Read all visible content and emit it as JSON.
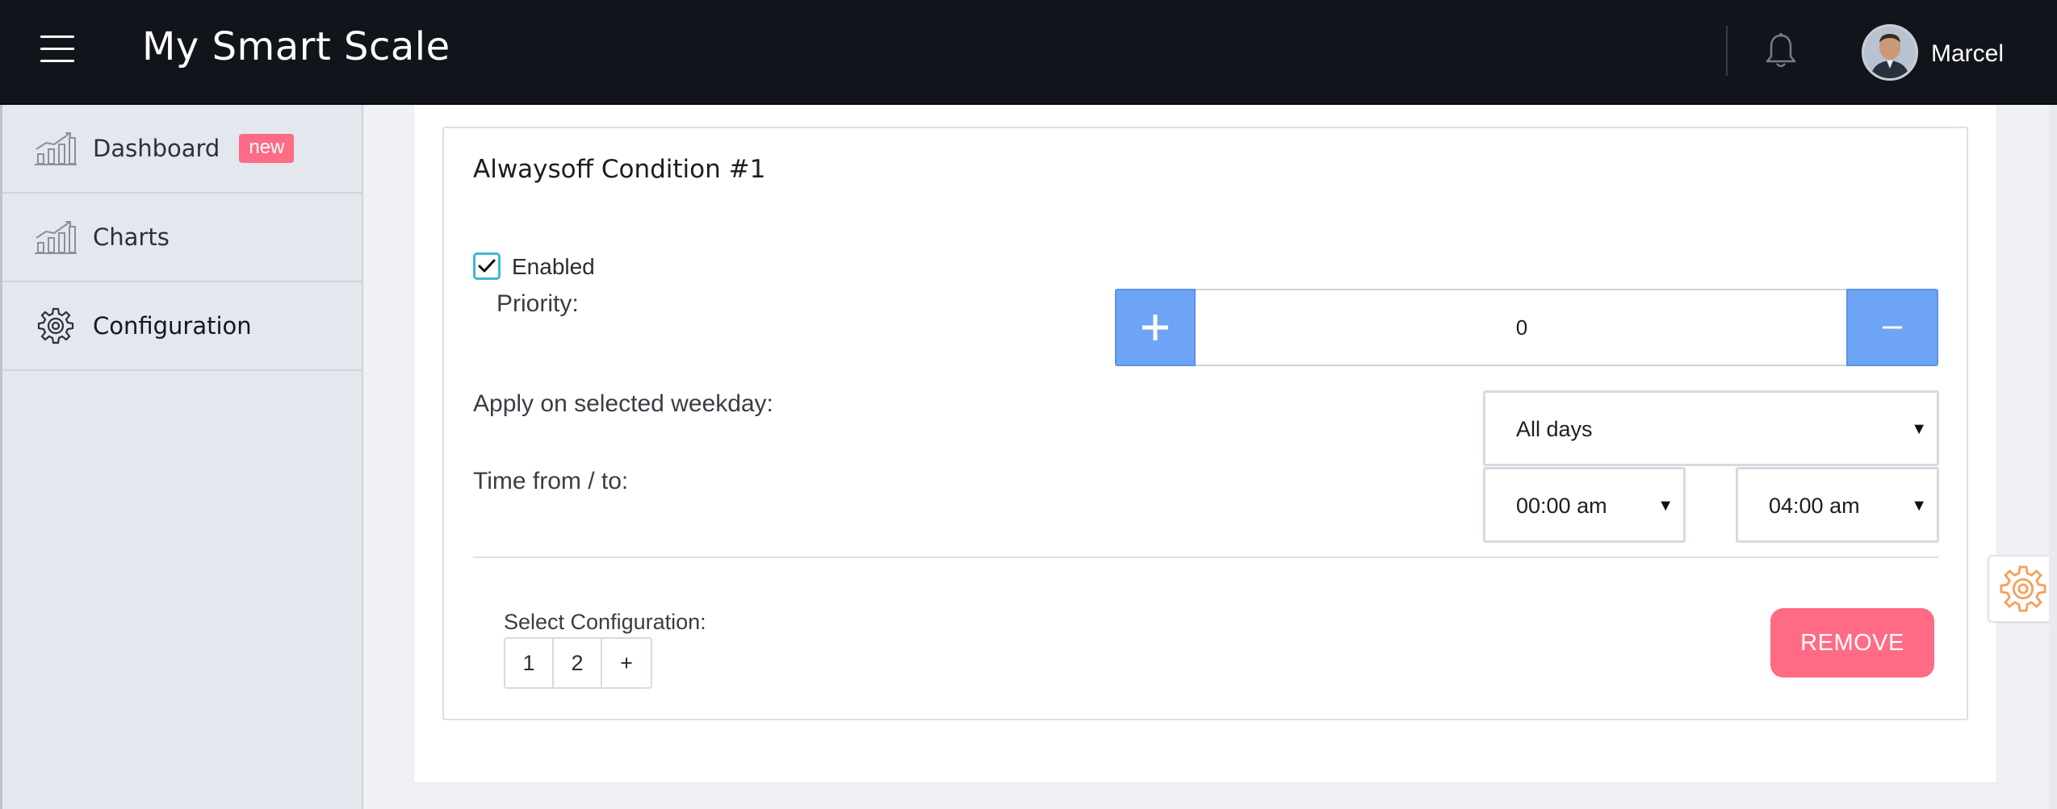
{
  "header": {
    "app_title": "My Smart Scale",
    "username": "Marcel",
    "bg_color": "#12141b"
  },
  "sidebar": {
    "items": [
      {
        "label": "Dashboard",
        "icon": "chart-growth-icon",
        "badge": "new"
      },
      {
        "label": "Charts",
        "icon": "chart-growth-icon"
      },
      {
        "label": "Configuration",
        "icon": "gear-icon",
        "active": true
      }
    ]
  },
  "condition": {
    "title": "Alwaysoff Condition #1",
    "enabled_label": "Enabled",
    "enabled": true,
    "priority_label": "Priority:",
    "priority_value": "0",
    "weekday_label": "Apply on selected weekday:",
    "weekday_value": "All days",
    "time_label": "Time from / to:",
    "time_from": "00:00 am",
    "time_to": "04:00 am"
  },
  "config_select": {
    "label": "Select Configuration:",
    "pages": [
      "1",
      "2",
      "+"
    ]
  },
  "remove_button": "REMOVE",
  "colors": {
    "accent_blue": "#6ea4f6",
    "accent_pink": "#ff6b85",
    "checkbox_border": "#3cb8d6",
    "float_gear": "#f5a05a"
  }
}
